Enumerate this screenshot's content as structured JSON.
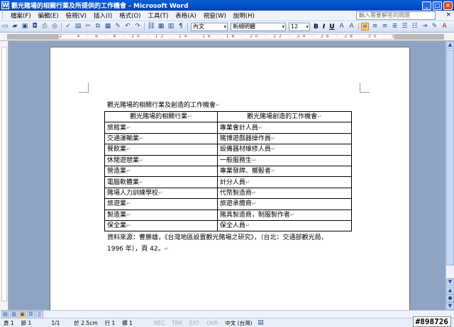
{
  "window": {
    "title": "觀光賭場的相關行業及所提供的工作機會 - Microsoft Word",
    "app_icon": "W"
  },
  "menu": {
    "items": [
      "檔案(F)",
      "編輯(E)",
      "檢視(V)",
      "插入(I)",
      "格式(O)",
      "工具(T)",
      "表格(A)",
      "視窗(W)",
      "說明(H)"
    ],
    "help_placeholder": "輸入需要解答的問題",
    "close_glyph": "×"
  },
  "toolbar": {
    "style_value": "內文",
    "font_value": "新細明體",
    "size_value": "12",
    "bold": "B",
    "italic": "I",
    "underline": "U"
  },
  "ruler": {
    "ticks": "2 · 4 · 6 · 8 · 10 · 12 · 14 · 16 · 18 · 20 · 22 · 24 · 26 · 28 · 30 · 32 · 34 · 36 · 38 · 40"
  },
  "document": {
    "caption": "觀光賭場的相關行業及創造的工作機會",
    "table": {
      "headers": [
        "觀光賭場的相關行業",
        "觀光賭場創造的工作機會"
      ],
      "rows": [
        [
          "旅館業",
          "專業會計人員"
        ],
        [
          "交通運輸業",
          "賭博遊戲器操作員"
        ],
        [
          "餐飲業",
          "設備器材維修人員"
        ],
        [
          "休閒遊憩業",
          "一般服務生"
        ],
        [
          "營造業",
          "專業發牌、擲骰者"
        ],
        [
          "電腦軟體業",
          "計分人員"
        ],
        [
          "賭場人力訓練學校",
          "代幣製造商"
        ],
        [
          "旅遊業",
          "旅遊承攬商"
        ],
        [
          "製造業",
          "賭具製造商，制服製作者"
        ],
        [
          "保全業",
          "保全人員"
        ]
      ]
    },
    "source_line1": "資料來源：曹勝雄，《台灣地區設置觀光賭場之研究》，（台北：交通部觀光局，",
    "source_line2": "1996 年），頁 42。"
  },
  "status": {
    "page": "頁 1",
    "section": "節 1",
    "page_of": "1/1",
    "position": "於 2.5cm",
    "line": "行 1",
    "column": "欄 1",
    "rec": "REC",
    "trk": "TRK",
    "ext": "EXT",
    "ovr": "OVR",
    "language": "中文 (台灣)"
  },
  "watermark": "#898726"
}
